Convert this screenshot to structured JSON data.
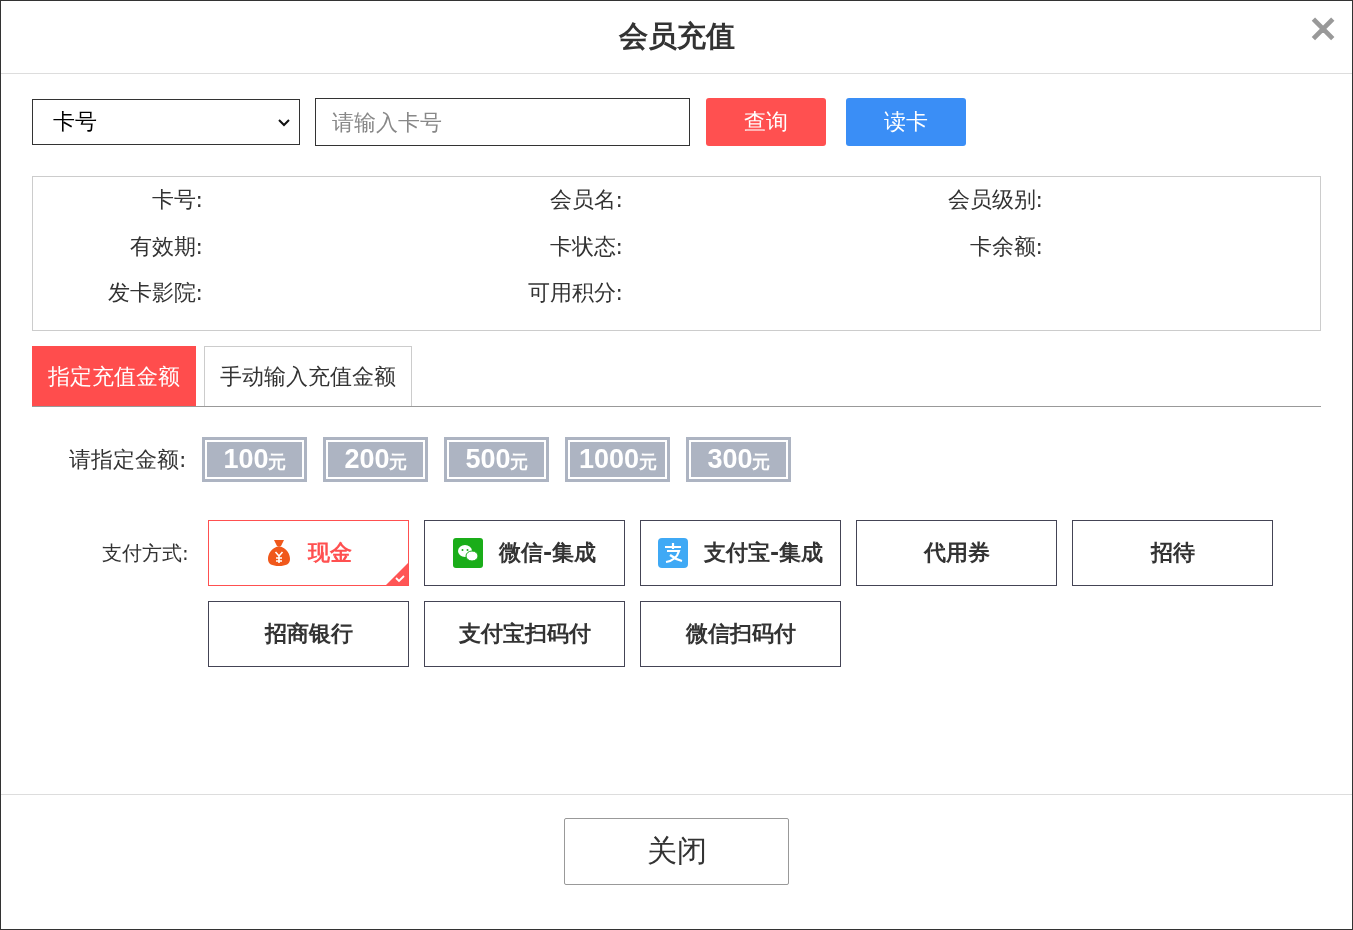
{
  "dialog": {
    "title": "会员充值",
    "close": "✕"
  },
  "search": {
    "type_select": "卡号",
    "placeholder": "请输入卡号",
    "buttons": [
      {
        "label": "查询",
        "kind": "danger"
      },
      {
        "label": "读卡",
        "kind": "primary"
      }
    ]
  },
  "info": [
    {
      "label": "卡号:"
    },
    {
      "label": "会员名:"
    },
    {
      "label": "会员级别:"
    },
    {
      "label": "有效期:"
    },
    {
      "label": "卡状态:"
    },
    {
      "label": "卡余额:"
    },
    {
      "label": "发卡影院:"
    },
    {
      "label": "可用积分:"
    }
  ],
  "tabs": [
    {
      "label": "指定充值金额",
      "selected": true
    },
    {
      "label": "手动输入充值金额",
      "selected": false
    }
  ],
  "amount_label": "请指定金额:",
  "amounts": [
    {
      "value": "100",
      "unit": "元"
    },
    {
      "value": "200",
      "unit": "元"
    },
    {
      "value": "500",
      "unit": "元"
    },
    {
      "value": "1000",
      "unit": "元"
    },
    {
      "value": "300",
      "unit": "元"
    }
  ],
  "payment_label": "支付方式:",
  "payments": [
    {
      "label": "现金",
      "kind": "cash",
      "selected": true
    },
    {
      "label": "微信-集成",
      "kind": "wechat",
      "selected": false
    },
    {
      "label": "支付宝-集成",
      "kind": "alipay",
      "selected": false
    },
    {
      "label": "代用券",
      "kind": "plain",
      "selected": false
    },
    {
      "label": "招待",
      "kind": "plain",
      "selected": false
    },
    {
      "label": "招商银行",
      "kind": "plain",
      "selected": false
    },
    {
      "label": "支付宝扫码付",
      "kind": "plain",
      "selected": false
    },
    {
      "label": "微信扫码付",
      "kind": "plain",
      "selected": false
    }
  ],
  "footer": {
    "close_button": "关闭"
  }
}
